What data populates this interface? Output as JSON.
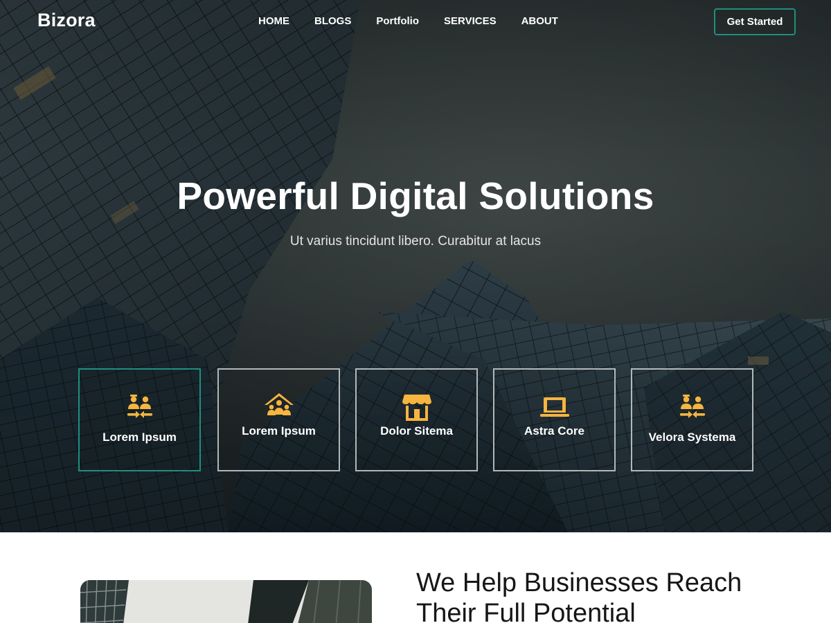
{
  "brand": {
    "logo": "Bizora",
    "accent": "#1f8f7f",
    "icon_color": "#f5b53f"
  },
  "nav": {
    "items": [
      "HOME",
      "BLOGS",
      "Portfolio",
      "SERVICES",
      "ABOUT"
    ],
    "cta": "Get Started"
  },
  "hero": {
    "title": "Powerful Digital Solutions",
    "subtitle": "Ut varius tincidunt libero. Curabitur at lacus"
  },
  "features": [
    {
      "label": "Lorem Ipsum",
      "icon": "people-exchange-icon",
      "active": true
    },
    {
      "label": "Lorem Ipsum",
      "icon": "family-home-icon",
      "active": false
    },
    {
      "label": "Dolor Sitema",
      "icon": "storefront-icon",
      "active": false
    },
    {
      "label": "Astra Core",
      "icon": "laptop-icon",
      "active": false
    },
    {
      "label": "Velora Systema",
      "icon": "people-exchange-icon",
      "active": false
    }
  ],
  "about": {
    "title": "We Help Businesses Reach Their Full Potential"
  }
}
